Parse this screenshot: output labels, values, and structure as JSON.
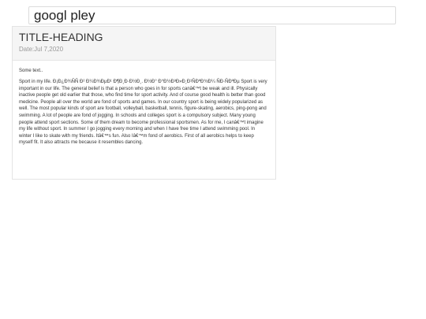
{
  "search": {
    "value": "googl pley"
  },
  "post": {
    "title": "TITLE-HEADING",
    "date": "Date:Jul 7,2020",
    "intro": "Some text..",
    "body": "Sport in my life. Ð¡Ð¿Ð¾ÑÑ Ð² Ð¼Ð¾ÐµÐ¹ Ð¶Ð¸Ð·Ð½Ð¸. Ð½Ð° Ð°Ð½Ð³Ð»Ð¸Ð¹ÑÐºÐ¾Ð¼ ÑÐ·ÑÐºÐµ Sport is very important in our life. The general belief is that a person who goes in for sports canâ€™t be weak and ill. Physically inactive people get old earlier that those, who find time for sport activity. And of course good health is better than good medicine. People all over the world are fond of sports and games. In our country sport is being widely popularized as well. The most popular kinds of sport are football, volleyball, basketball, tennis, figure-skating, aerobics, ping-pong and swimming. A lot of people are fond of jogging. In schools and colleges sport is a compulsory subject. Many young people attend sport sections. Some of them dream to become professional sportsmen. As for me, I canâ€™t imagine my life without sport. In summer I go jogging every morning and when I have free time I attend swimming pool. In winter I like to skate with my friends. Itâ€™s fun. Also Iâ€™m fond of aerobics. First of all aerobics helps to keep myself fit. It also attracts me because it resembles dancing."
  }
}
